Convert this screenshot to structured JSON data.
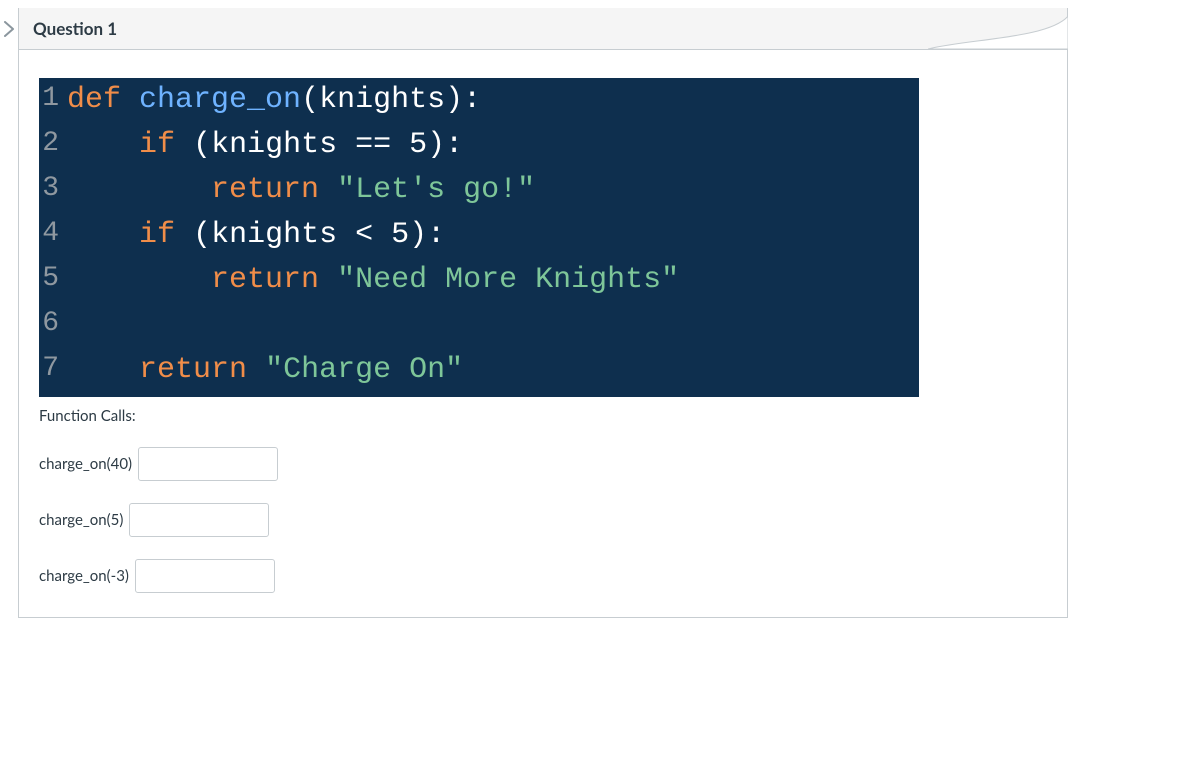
{
  "header": {
    "title": "Question 1"
  },
  "code": {
    "lines": [
      {
        "n": "1",
        "segments": [
          {
            "cls": "kw-orange",
            "t": "def"
          },
          {
            "cls": "id",
            "t": " "
          },
          {
            "cls": "fn-name",
            "t": "charge_on"
          },
          {
            "cls": "paren",
            "t": "("
          },
          {
            "cls": "id",
            "t": "knights"
          },
          {
            "cls": "paren",
            "t": "):"
          }
        ]
      },
      {
        "n": "2",
        "segments": [
          {
            "cls": "id",
            "t": "    "
          },
          {
            "cls": "kw-if",
            "t": "if"
          },
          {
            "cls": "id",
            "t": " "
          },
          {
            "cls": "paren",
            "t": "("
          },
          {
            "cls": "id",
            "t": "knights "
          },
          {
            "cls": "op",
            "t": "== "
          },
          {
            "cls": "num",
            "t": "5"
          },
          {
            "cls": "paren",
            "t": "):"
          }
        ]
      },
      {
        "n": "3",
        "segments": [
          {
            "cls": "id",
            "t": "        "
          },
          {
            "cls": "kw-ret",
            "t": "return"
          },
          {
            "cls": "id",
            "t": " "
          },
          {
            "cls": "str",
            "t": "\"Let's go!\""
          }
        ]
      },
      {
        "n": "4",
        "segments": [
          {
            "cls": "id",
            "t": "    "
          },
          {
            "cls": "kw-if",
            "t": "if"
          },
          {
            "cls": "id",
            "t": " "
          },
          {
            "cls": "paren",
            "t": "("
          },
          {
            "cls": "id",
            "t": "knights "
          },
          {
            "cls": "op",
            "t": "< "
          },
          {
            "cls": "num",
            "t": "5"
          },
          {
            "cls": "paren",
            "t": "):"
          }
        ]
      },
      {
        "n": "5",
        "segments": [
          {
            "cls": "id",
            "t": "        "
          },
          {
            "cls": "kw-ret",
            "t": "return"
          },
          {
            "cls": "id",
            "t": " "
          },
          {
            "cls": "str",
            "t": "\"Need More Knights\""
          }
        ]
      },
      {
        "n": "6",
        "segments": [
          {
            "cls": "id",
            "t": " "
          }
        ]
      },
      {
        "n": "7",
        "segments": [
          {
            "cls": "id",
            "t": "    "
          },
          {
            "cls": "kw-ret",
            "t": "return"
          },
          {
            "cls": "id",
            "t": " "
          },
          {
            "cls": "str",
            "t": "\"Charge On\""
          }
        ]
      }
    ]
  },
  "function_calls": {
    "heading": "Function Calls:",
    "items": [
      {
        "label": "charge_on(40)",
        "value": ""
      },
      {
        "label": "charge_on(5)",
        "value": ""
      },
      {
        "label": "charge_on(-3)",
        "value": ""
      }
    ]
  }
}
